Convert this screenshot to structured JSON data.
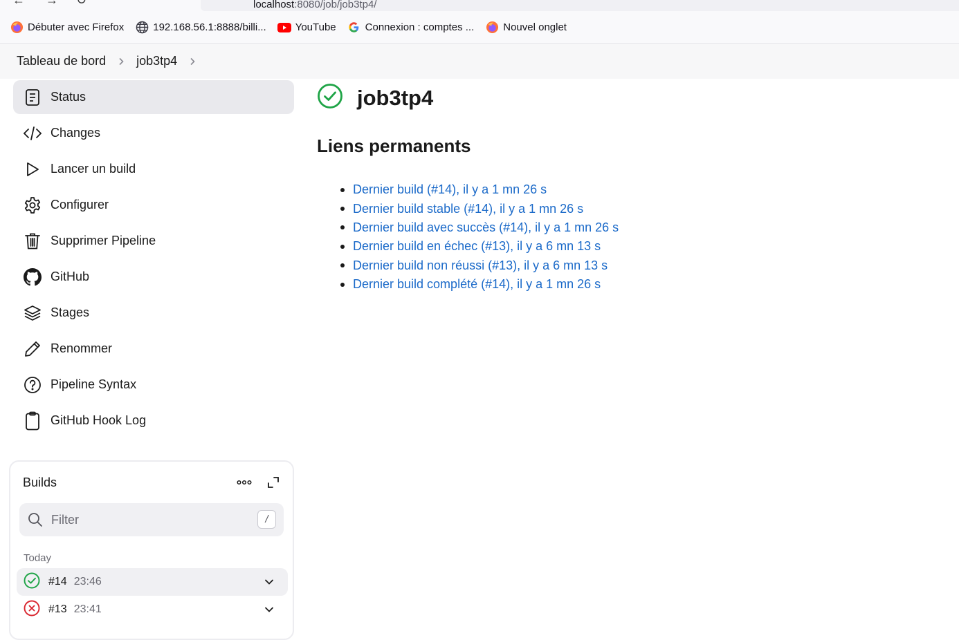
{
  "browser": {
    "url_host": "localhost",
    "url_path": ":8080/job/job3tp4/",
    "bookmarks": [
      {
        "label": "Débuter avec Firefox",
        "icon": "firefox-icon"
      },
      {
        "label": "192.168.56.1:8888/billi...",
        "icon": "globe-icon"
      },
      {
        "label": "YouTube",
        "icon": "youtube-icon"
      },
      {
        "label": "Connexion : comptes ...",
        "icon": "google-icon"
      },
      {
        "label": "Nouvel onglet",
        "icon": "firefox-icon"
      }
    ]
  },
  "breadcrumb": {
    "items": [
      "Tableau de bord",
      "job3tp4"
    ]
  },
  "sidebar": {
    "items": [
      {
        "label": "Status",
        "icon": "document-icon",
        "active": true
      },
      {
        "label": "Changes",
        "icon": "code-icon"
      },
      {
        "label": "Lancer un build",
        "icon": "play-icon"
      },
      {
        "label": "Configurer",
        "icon": "gear-icon"
      },
      {
        "label": "Supprimer Pipeline",
        "icon": "trash-icon"
      },
      {
        "label": "GitHub",
        "icon": "github-icon"
      },
      {
        "label": "Stages",
        "icon": "layers-icon"
      },
      {
        "label": "Renommer",
        "icon": "pencil-icon"
      },
      {
        "label": "Pipeline Syntax",
        "icon": "help-icon"
      },
      {
        "label": "GitHub Hook Log",
        "icon": "clipboard-icon"
      }
    ]
  },
  "builds": {
    "title": "Builds",
    "filter_placeholder": "Filter",
    "filter_shortcut": "/",
    "group_label": "Today",
    "rows": [
      {
        "number": "#14",
        "time": "23:46",
        "status": "success"
      },
      {
        "number": "#13",
        "time": "23:41",
        "status": "failure"
      }
    ]
  },
  "main": {
    "job_name": "job3tp4",
    "status_icon": "success-check-icon",
    "permalinks_heading": "Liens permanents",
    "permalinks": [
      "Dernier build (#14), il y a 1 mn 26 s",
      "Dernier build stable (#14), il y a 1 mn 26 s",
      "Dernier build avec succès (#14), il y a 1 mn 26 s",
      "Dernier build en échec (#13), il y a 6 mn 13 s",
      "Dernier build non réussi (#13), il y a 6 mn 13 s",
      "Dernier build complété (#14), il y a 1 mn 26 s"
    ]
  },
  "colors": {
    "link": "#1b6ac9",
    "success": "#1ea446",
    "failure": "#d9262f",
    "active_bg": "#e9e9ed"
  }
}
